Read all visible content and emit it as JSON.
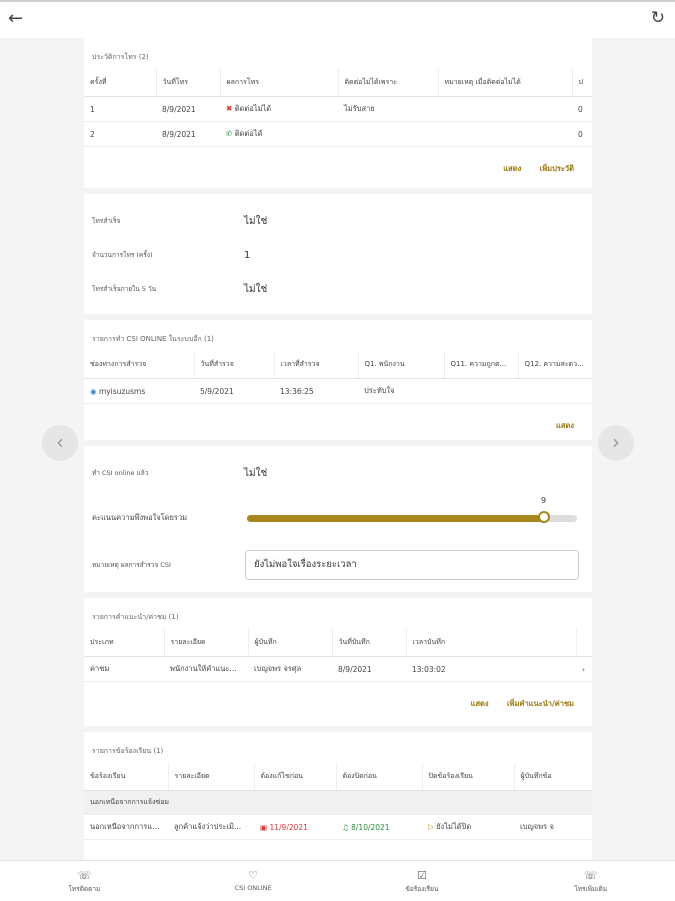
{
  "toolbar": {
    "back_icon": "←",
    "refresh_icon": "↻"
  },
  "call_history": {
    "title": "ประวัติการโทร (2)",
    "headers": [
      "ครั้งที่",
      "วันที่โทร",
      "ผลการโทร",
      "ติดต่อไม่ได้เพราะ",
      "หมายเหตุ เมื่อติดต่อไม่ได้",
      "ป"
    ],
    "rows": [
      {
        "no": "1",
        "date": "8/9/2021",
        "result": "ติดต่อไม่ได้",
        "reason": "ไม่รับสาย",
        "remark": "",
        "extra": "0"
      },
      {
        "no": "2",
        "date": "8/9/2021",
        "result": "ติดต่อได้",
        "reason": "",
        "remark": "",
        "extra": "0"
      }
    ],
    "show_label": "แสดง",
    "add_label": "เพิ่มประวัติ"
  },
  "call_info": {
    "rows": [
      {
        "label": "โทรสำเร็จ",
        "value": "ไม่ใช่"
      },
      {
        "label": "จำนวนการโทร (ครั้ง)",
        "value": "1"
      },
      {
        "label": "โทรสำเร็จภายใน 5 วัน",
        "value": "ไม่ใช่"
      }
    ]
  },
  "csi_online": {
    "title": "รายการทำ CSI ONLINE ในระบบอื่ก (1)",
    "headers": [
      "ช่องทางการสำรวจ",
      "วันที่สำรวจ",
      "เวลาที่สำรวจ",
      "Q1. พนักงาน",
      "Q11. ความถูกต...",
      "Q12. ความสะดว..."
    ],
    "rows": [
      {
        "channel": "myisuzusms",
        "date": "5/9/2021",
        "time": "13:36:25",
        "q1": "ประทับใจ",
        "q11": "",
        "q12": ""
      }
    ],
    "show_label": "แสดง"
  },
  "csi_result": {
    "done_label": "ทำ CSI online แล้ว",
    "done_value": "ไม่ใช่",
    "satisfaction_label": "คะแนนความพึงพอใจโดยรวม",
    "satisfaction_value": 9,
    "satisfaction_max": 10,
    "remark_label": "หมายเหตุ ผลการสำรวจ CSI",
    "remark_value": "ยังไม่พอใจเรื่องระยะเวลา"
  },
  "complaint_advice": {
    "title": "รายการคำแนะนำ/ค่าชม (1)",
    "headers": [
      "ประเภท",
      "รายละเอียด",
      "ผู้บันทึก",
      "วันที่บันทึก",
      "เวลาบันทึก"
    ],
    "rows": [
      {
        "type": "ค่าชม",
        "detail": "พนักงานให้คำแนะ...",
        "recorder": "เบญจพร จรศุล",
        "date": "8/9/2021",
        "time": "13:03:02",
        "arrow": "›"
      }
    ],
    "show_label": "แสดง",
    "add_label": "เพิ่มคำแนะนำ/ค่าชม"
  },
  "complaints": {
    "title": "รายการข้อร้องเรียน (1)",
    "headers": [
      "ข้อร้องเรียน",
      "รายละเอียด",
      "ต้องแก้ไขก่อน",
      "ต้องปิดก่อน",
      "ปิดข้อร้องเรียน",
      "ผู้บันทึกข้อ"
    ],
    "group": "นอกเหนือจากการแจ้งซ่อม",
    "rows": [
      {
        "topic": "นอกเหนือจากการแจ้...",
        "detail": "ลูกค้าแจ้งว่าประเมิ...",
        "fix_by": "11/9/2021",
        "close_by": "8/10/2021",
        "status": "ยังไม่ได้ปิด",
        "recorder": "เบญจพร จ"
      }
    ]
  },
  "bottom_nav": [
    {
      "icon": "☏",
      "label": "โทรติดตาม"
    },
    {
      "icon": "♡",
      "label": "CSI ONLINE"
    },
    {
      "icon": "☑",
      "label": "ข้อร้องเรียน"
    },
    {
      "icon": "☏",
      "label": "โทรเพิ่มเติม"
    }
  ],
  "pager": {
    "prev_icon": "‹",
    "next_icon": "›"
  }
}
